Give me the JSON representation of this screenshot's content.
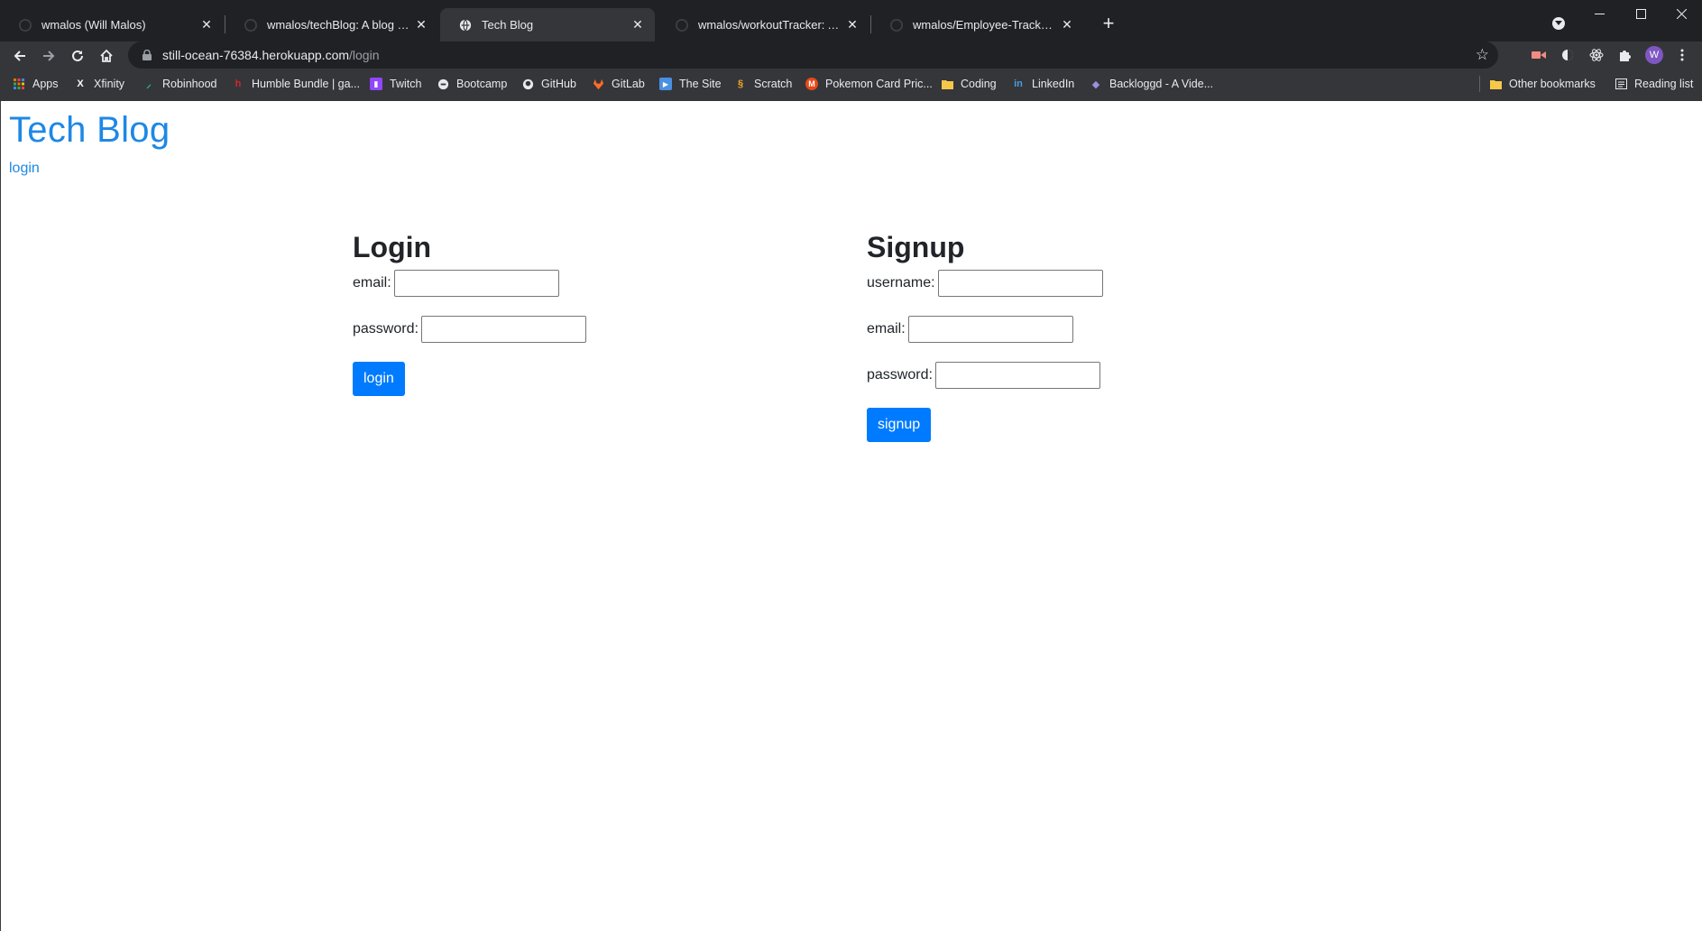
{
  "browser": {
    "tabs": [
      {
        "title": "wmalos (Will Malos)",
        "favicon": "github-icon",
        "active": false
      },
      {
        "title": "wmalos/techBlog: A blog where y",
        "favicon": "github-icon",
        "active": false
      },
      {
        "title": "Tech Blog",
        "favicon": "globe-icon",
        "active": true
      },
      {
        "title": "wmalos/workoutTracker: An app",
        "favicon": "github-icon",
        "active": false
      },
      {
        "title": "wmalos/Employee-Tracker: Emplo",
        "favicon": "github-icon",
        "active": false
      }
    ],
    "new_tab_label": "+",
    "url_host": "still-ocean-76384.herokuapp.com",
    "url_path": "/login",
    "profile_initial": "W",
    "bookmarks": [
      {
        "label": "Apps",
        "icon": "apps-grid-icon",
        "color": "#e37400"
      },
      {
        "label": "Xfinity",
        "icon": "xfinity-icon",
        "color": "#ffffff"
      },
      {
        "label": "Robinhood",
        "icon": "robinhood-icon",
        "color": "#21ce99"
      },
      {
        "label": "Humble Bundle | ga...",
        "icon": "humble-icon",
        "color": "#cc2929"
      },
      {
        "label": "Twitch",
        "icon": "twitch-icon",
        "color": "#9146ff"
      },
      {
        "label": "Bootcamp",
        "icon": "bootcamp-icon",
        "color": "#e8eaed"
      },
      {
        "label": "GitHub",
        "icon": "github-icon",
        "color": "#e8eaed"
      },
      {
        "label": "GitLab",
        "icon": "gitlab-icon",
        "color": "#fc6d26"
      },
      {
        "label": "The Site",
        "icon": "the-site-icon",
        "color": "#4a90e2"
      },
      {
        "label": "Scratch",
        "icon": "scratch-icon",
        "color": "#f9a825"
      },
      {
        "label": "Pokemon Card Pric...",
        "icon": "pokemon-icon",
        "color": "#e64a19"
      },
      {
        "label": "Coding",
        "icon": "folder-icon",
        "color": "#f5c84c"
      },
      {
        "label": "LinkedIn",
        "icon": "linkedin-icon",
        "color": "#2867b2"
      },
      {
        "label": "Backloggd - A Vide...",
        "icon": "backloggd-icon",
        "color": "#9c8fe0"
      }
    ],
    "other_bookmarks": "Other bookmarks",
    "reading_list": "Reading list"
  },
  "site": {
    "title": "Tech Blog",
    "nav_login": "login"
  },
  "login_form": {
    "heading": "Login",
    "email_label": "email:",
    "password_label": "password:",
    "submit_label": "login"
  },
  "signup_form": {
    "heading": "Signup",
    "username_label": "username:",
    "email_label": "email:",
    "password_label": "password:",
    "submit_label": "signup"
  },
  "colors": {
    "accent": "#007bff",
    "link": "#1e88e5"
  }
}
